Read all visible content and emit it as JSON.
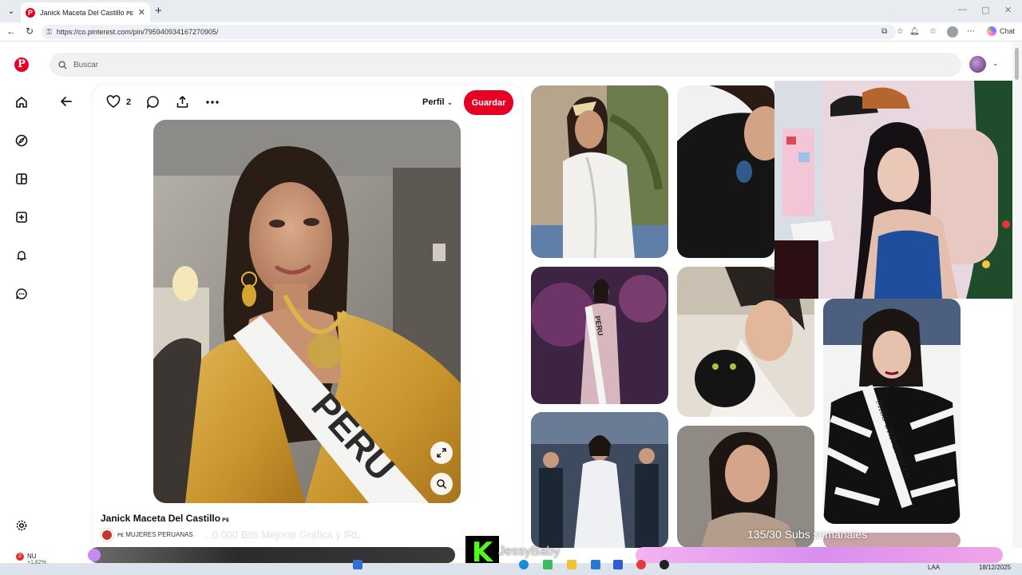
{
  "browser": {
    "tab_title": "Janick Maceta Del Castillo ᴘᴇ",
    "tab_close": "✕",
    "new_tab": "+",
    "url": "https://co.pinterest.com/pin/795940934167270905/",
    "chat_label": "Chat"
  },
  "search": {
    "placeholder": "Buscar"
  },
  "pin": {
    "like_count": "2",
    "profile_label": "Perfil",
    "save_label": "Guardar",
    "title": "Janick Maceta Del Castillo",
    "title_suffix": "ᴘᴇ",
    "board_name": "ᴘᴇ MUJERES PERUANAS",
    "sash_text": "PERU"
  },
  "grid": {
    "sash_peru": "PERU",
    "sash_miss_universe": "MISS UNIVERSE VE"
  },
  "overlay": {
    "ghost_text": "...0.000 Bits Mejorar Gráfica y IRL",
    "subs_text": "135/30 Subs semanales",
    "streamer_name": "JessyBaby",
    "kick_letter": "K"
  },
  "taskbar": {
    "badge": "2",
    "weather_label": "NU",
    "weather_change": "+1,82%",
    "lang": "LAA",
    "date": "18/12/2025"
  },
  "icons": [
    "chevron-down-icon",
    "close-icon",
    "plus-icon",
    "back-arrow-icon",
    "refresh-icon",
    "lock-icon",
    "star-icon",
    "bell-icon",
    "pinterest-logo",
    "home-icon",
    "compass-icon",
    "board-icon",
    "create-icon",
    "notification-icon",
    "messages-icon",
    "settings-icon",
    "search-icon",
    "heart-icon",
    "comment-icon",
    "share-icon",
    "more-icon",
    "expand-icon",
    "visual-search-icon"
  ],
  "colors": {
    "brand": "#e60023",
    "kick_green": "#53fc18"
  }
}
